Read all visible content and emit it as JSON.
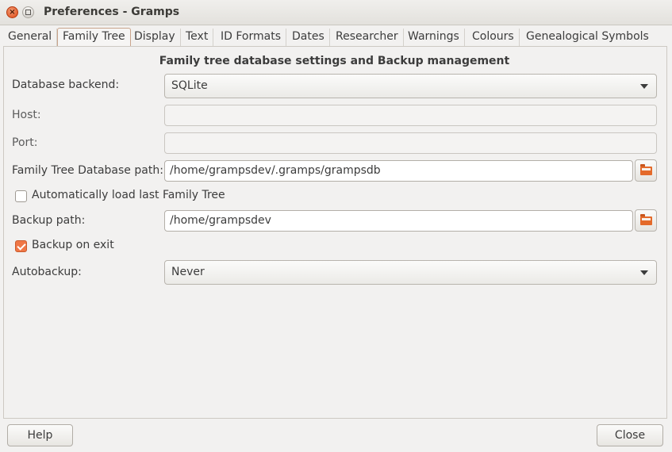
{
  "window": {
    "title": "Preferences - Gramps"
  },
  "tabs": [
    {
      "label": "General"
    },
    {
      "label": "Family Tree"
    },
    {
      "label": "Display"
    },
    {
      "label": "Text"
    },
    {
      "label": "ID Formats"
    },
    {
      "label": "Dates"
    },
    {
      "label": "Researcher"
    },
    {
      "label": "Warnings"
    },
    {
      "label": "Colours"
    },
    {
      "label": "Genealogical Symbols"
    }
  ],
  "active_tab": "Family Tree",
  "section_heading": "Family tree database settings and Backup management",
  "form": {
    "database_backend": {
      "label": "Database backend:",
      "value": "SQLite"
    },
    "host": {
      "label": "Host:",
      "value": ""
    },
    "port": {
      "label": "Port:",
      "value": ""
    },
    "db_path": {
      "label": "Family Tree Database path:",
      "value": "/home/grampsdev/.gramps/grampsdb"
    },
    "autoload": {
      "label": "Automatically load last Family Tree",
      "checked": false
    },
    "backup_path": {
      "label": "Backup path:",
      "value": "/home/grampsdev"
    },
    "backup_on_exit": {
      "label": "Backup on exit",
      "checked": true
    },
    "autobackup": {
      "label": "Autobackup:",
      "value": "Never"
    }
  },
  "buttons": {
    "help": "Help",
    "close": "Close"
  },
  "colors": {
    "accent": "#f07746",
    "close_button": "#df4a16",
    "folder_icon": "#e46a2a"
  }
}
